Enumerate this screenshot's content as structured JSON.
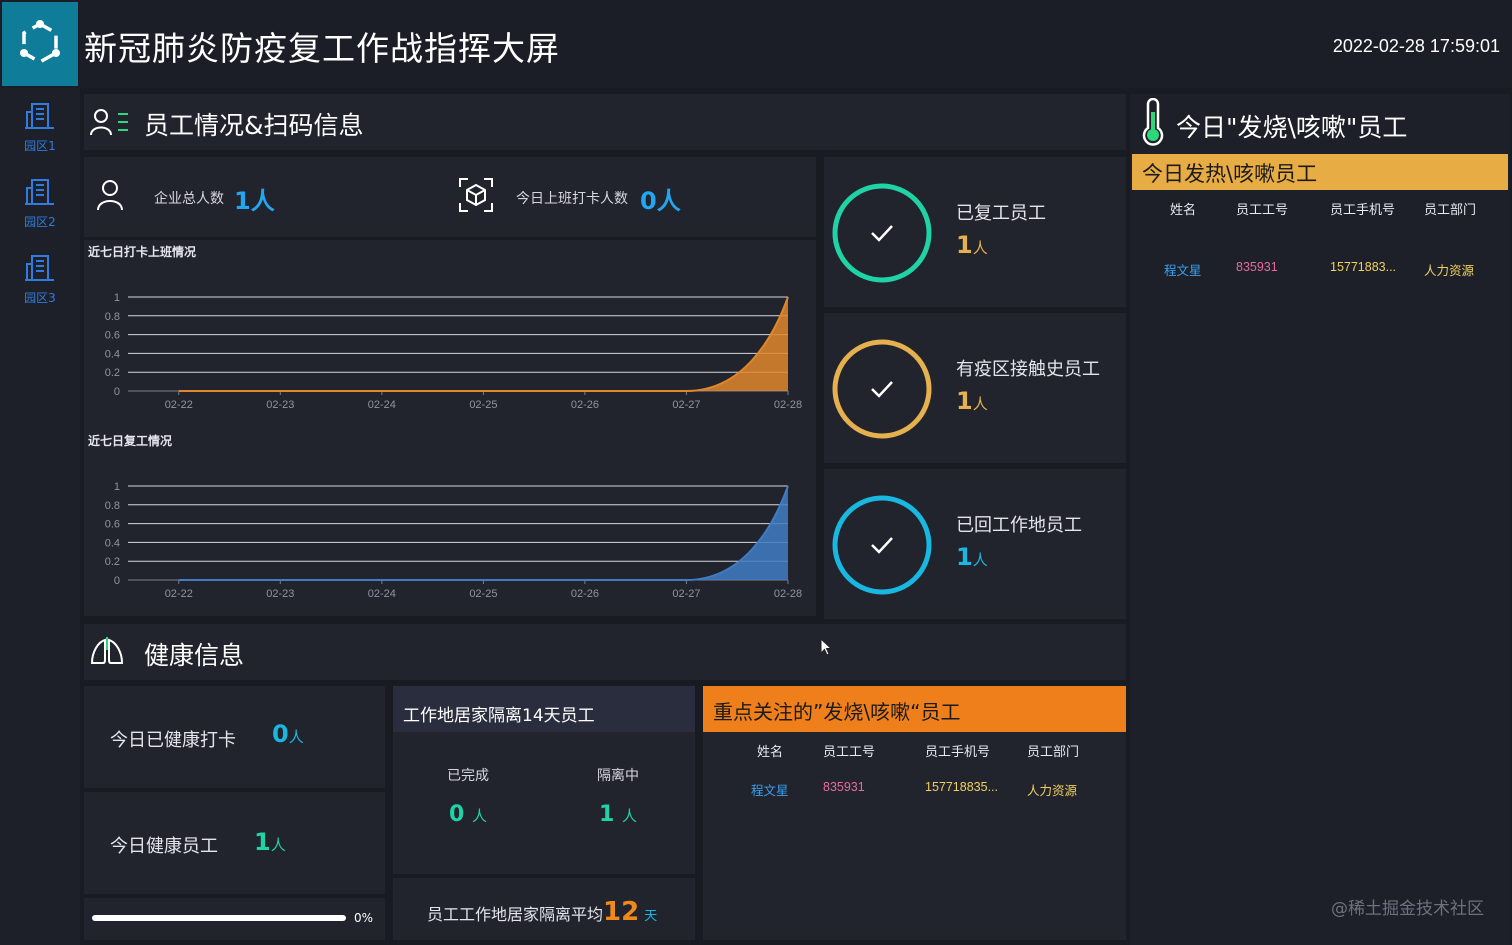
{
  "header": {
    "title": "新冠肺炎防疫复工作战指挥大屏",
    "datetime": "2022-02-28 17:59:01"
  },
  "sidebar": {
    "items": [
      {
        "label": "园区1",
        "icon": "building-icon"
      },
      {
        "label": "园区2",
        "icon": "building-icon"
      },
      {
        "label": "园区3",
        "icon": "building-icon"
      }
    ]
  },
  "employee_section": {
    "title": "员工情况&扫码信息",
    "total_label": "企业总人数",
    "total_value": "1人",
    "checkin_label": "今日上班打卡人数",
    "checkin_value": "0人"
  },
  "chart_data": [
    {
      "type": "area",
      "title": "近七日打卡上班情况",
      "categories": [
        "02-22",
        "02-23",
        "02-24",
        "02-25",
        "02-26",
        "02-27",
        "02-28"
      ],
      "values": [
        0,
        0,
        0,
        0,
        0,
        0,
        1
      ],
      "ylim": [
        0,
        1
      ],
      "yticks": [
        "0",
        "0.2",
        "0.4",
        "0.6",
        "0.8",
        "1"
      ],
      "color": "#e0872c",
      "grid": true
    },
    {
      "type": "area",
      "title": "近七日复工情况",
      "categories": [
        "02-22",
        "02-23",
        "02-24",
        "02-25",
        "02-26",
        "02-27",
        "02-28"
      ],
      "values": [
        0,
        0,
        0,
        0,
        0,
        0,
        1
      ],
      "ylim": [
        0,
        1
      ],
      "yticks": [
        "0",
        "0.2",
        "0.4",
        "0.6",
        "0.8",
        "1"
      ],
      "color": "#3f7cc4",
      "grid": true
    }
  ],
  "status_cards": [
    {
      "label": "已复工员工",
      "value": "1",
      "unit": "人",
      "color": "#1fd3a7"
    },
    {
      "label": "有疫区接触史员工",
      "value": "1",
      "unit": "人",
      "color": "#e6b04e"
    },
    {
      "label": "已回工作地员工",
      "value": "1",
      "unit": "人",
      "color": "#19b8e0"
    }
  ],
  "fever_panel": {
    "title": "今日\"发烧\\咳嗽\"员工",
    "subtitle": "今日发热\\咳嗽员工",
    "columns": [
      "姓名",
      "员工工号",
      "员工手机号",
      "员工部门"
    ],
    "rows": [
      {
        "name": "程文星",
        "id": "835931",
        "phone": "15771883...",
        "dept": "人力资源"
      }
    ]
  },
  "health_section": {
    "title": "健康信息",
    "checkin_label": "今日已健康打卡",
    "checkin_value": "0",
    "healthy_label": "今日健康员工",
    "healthy_value": "1",
    "unit": "人",
    "progress_percent": 0,
    "progress_text": "0%"
  },
  "quarantine": {
    "title": "工作地居家隔离14天员工",
    "done_label": "已完成",
    "done_value": "0",
    "ongoing_label": "隔离中",
    "ongoing_value": "1",
    "unit": "人",
    "avg_label": "员工工作地居家隔离平均",
    "avg_value": "12",
    "avg_unit": "天"
  },
  "focus_panel": {
    "title": "重点关注的”发烧\\咳嗽“员工",
    "columns": [
      "姓名",
      "员工工号",
      "员工手机号",
      "员工部门"
    ],
    "rows": [
      {
        "name": "程文星",
        "id": "835931",
        "phone": "157718835...",
        "dept": "人力资源"
      }
    ]
  },
  "watermark": "@稀土掘金技术社区"
}
